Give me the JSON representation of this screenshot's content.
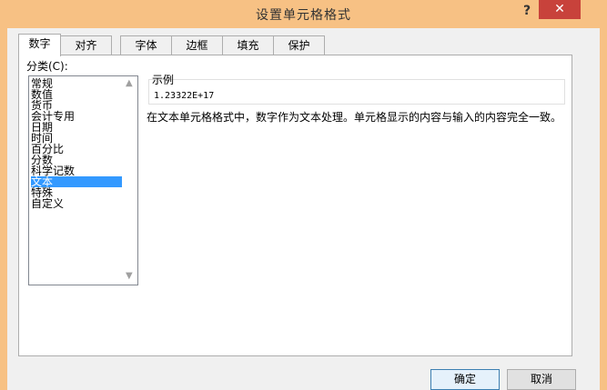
{
  "dialog": {
    "title": "设置单元格格式",
    "help_glyph": "?",
    "close_glyph": "✕"
  },
  "tabs": [
    {
      "label": "数字"
    },
    {
      "label": "对齐"
    },
    {
      "label": "字体"
    },
    {
      "label": "边框"
    },
    {
      "label": "填充"
    },
    {
      "label": "保护"
    }
  ],
  "category": {
    "label": "分类(C):",
    "items": [
      "常规",
      "数值",
      "货币",
      "会计专用",
      "日期",
      "时间",
      "百分比",
      "分数",
      "科学记数",
      "文本",
      "特殊",
      "自定义"
    ],
    "selected_index": 9
  },
  "sample": {
    "label": "示例",
    "value": "1.23322E+17"
  },
  "description": "在文本单元格格式中，数字作为文本处理。单元格显示的内容与输入的内容完全一致。",
  "buttons": {
    "ok": "确定",
    "cancel": "取消"
  },
  "colors": {
    "title_bar": "#f7c184",
    "close_button": "#c8423b",
    "selection": "#3399ff"
  }
}
